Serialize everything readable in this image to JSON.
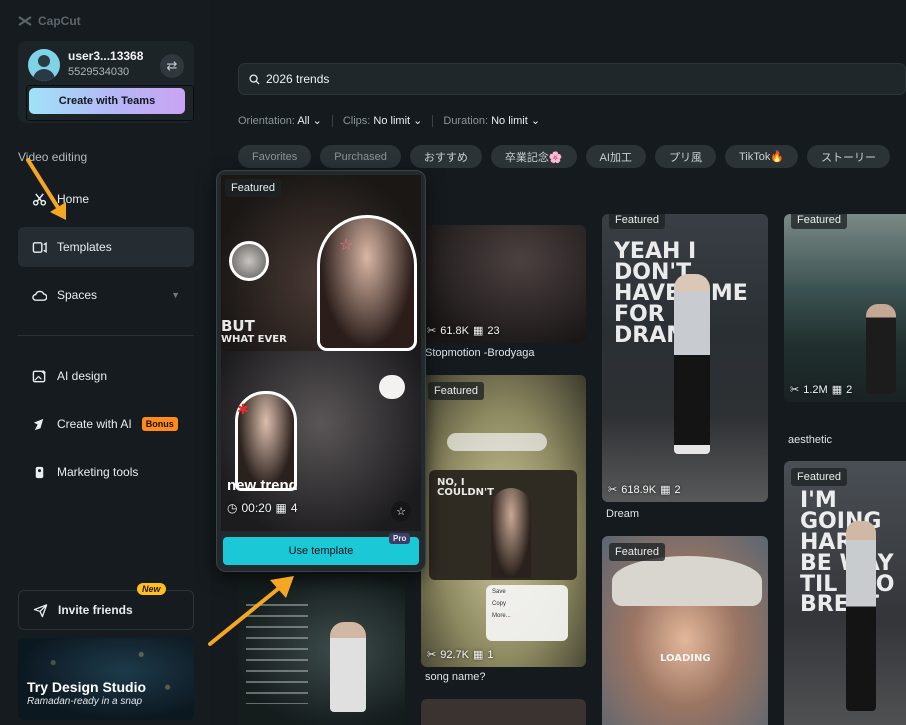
{
  "app": {
    "logo_text": "CapCut"
  },
  "account": {
    "username": "user3...13368",
    "user_id": "5529534030",
    "teams_button": "Create with Teams"
  },
  "sidebar": {
    "section_label": "Video editing",
    "items": [
      {
        "label": "Home",
        "icon": "scissors-icon"
      },
      {
        "label": "Templates",
        "icon": "template-icon",
        "active": true
      },
      {
        "label": "Spaces",
        "icon": "cloud-icon"
      },
      {
        "label": "AI design",
        "icon": "ai-image-icon"
      },
      {
        "label": "Create with AI",
        "icon": "sparkle-icon",
        "badge": "Bonus"
      },
      {
        "label": "Marketing tools",
        "icon": "marketing-icon"
      }
    ],
    "invite": {
      "label": "Invite friends",
      "badge": "New"
    },
    "studio": {
      "title": "Try Design Studio",
      "subtitle": "Ramadan-ready in a snap"
    }
  },
  "search": {
    "value": "2026 trends"
  },
  "filters": [
    {
      "label": "Orientation:",
      "value": "All"
    },
    {
      "label": "Clips:",
      "value": "No limit"
    },
    {
      "label": "Duration:",
      "value": "No limit"
    }
  ],
  "chips": [
    "Favorites",
    "Purchased",
    "おすすめ",
    "卒業記念🌸",
    "AI加工",
    "プリ風",
    "TikTok🔥",
    "ストーリー"
  ],
  "preview": {
    "badge": "Featured",
    "top_text_1": "BUT",
    "top_text_2": "WHAT EVER",
    "title": "new trend",
    "duration": "00:20",
    "clips": "4",
    "use_button": "Use template",
    "pro_badge": "Pro"
  },
  "cards": {
    "c1": {
      "uses": "61.8K",
      "clips": "23",
      "caption": "Stopmotion -Brodyaga"
    },
    "c2": {
      "badge": "Featured",
      "uses": "92.7K",
      "clips": "1",
      "caption": "song name?",
      "overlay_text": "NO, I COULDN'T",
      "menu": [
        "Save",
        "Copy",
        "More..."
      ]
    },
    "c3": {
      "badge": "Featured",
      "uses": "618.9K",
      "clips": "2",
      "caption": "Dream",
      "overlay_text": "YEAH I DON'T HAVE TIME FOR NO DRAMA"
    },
    "c4": {
      "badge": "Featured",
      "uses": "1.2M",
      "clips": "2",
      "caption": "aesthetic"
    },
    "c5": {
      "badge": "Featured",
      "overlay_text": "LOADING"
    },
    "c6": {
      "badge": "Featured",
      "overlay_text": "I'M GOING HARD BE WAY TIL STO BREAT"
    }
  },
  "colors": {
    "accent": "#1ac8d6",
    "bonus": "#ff8b1a",
    "annotation_arrow": "#f5a623"
  }
}
